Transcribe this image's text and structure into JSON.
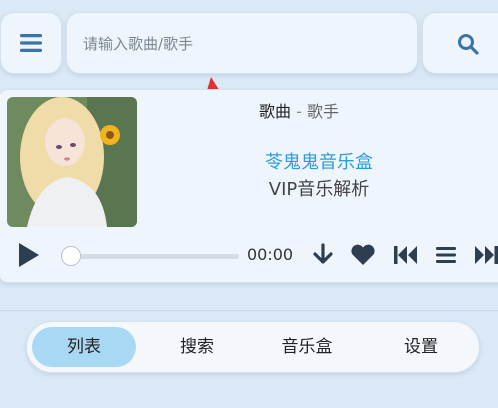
{
  "search": {
    "placeholder": "请输入歌曲/歌手"
  },
  "player": {
    "song": "歌曲",
    "separator": "-",
    "artist": "歌手",
    "app_name": "苓鬼鬼音乐盒",
    "app_subtitle": "VIP音乐解析",
    "time": "00:00",
    "progress": 0
  },
  "tabs": [
    {
      "label": "列表",
      "active": true
    },
    {
      "label": "搜索",
      "active": false
    },
    {
      "label": "音乐盒",
      "active": false
    },
    {
      "label": "设置",
      "active": false
    }
  ],
  "colors": {
    "accent": "#2b9ddb",
    "icon": "#3a73a8",
    "annotation_arrow": "#e03030"
  }
}
